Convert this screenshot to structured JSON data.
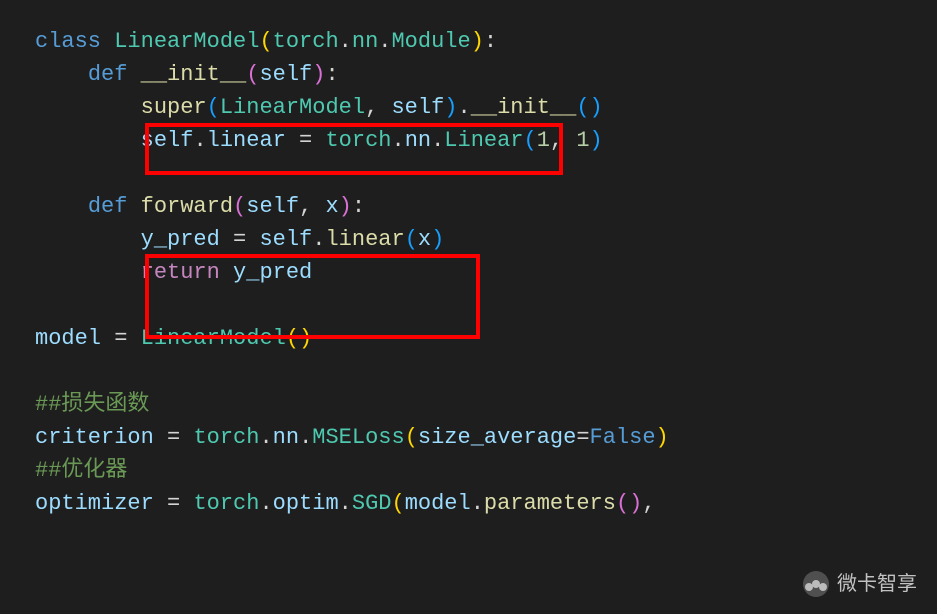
{
  "code": {
    "l1": {
      "t1": "class ",
      "t2": "LinearModel",
      "t3": "(",
      "t4": "torch",
      "t5": ".",
      "t6": "nn",
      "t7": ".",
      "t8": "Module",
      "t9": ")",
      "t10": ":"
    },
    "l2": {
      "t1": "    ",
      "t2": "def ",
      "t3": "__init__",
      "t4": "(",
      "t5": "self",
      "t6": ")",
      "t7": ":"
    },
    "l3": {
      "t1": "        ",
      "t2": "super",
      "t3": "(",
      "t4": "LinearModel",
      "t5": ", ",
      "t6": "self",
      "t7": ")",
      "t8": ".",
      "t9": "__init__",
      "t10": "()"
    },
    "l4": {
      "t1": "        ",
      "t2": "self",
      "t3": ".",
      "t4": "linear",
      "t5": " = ",
      "t6": "torch",
      "t7": ".",
      "t8": "nn",
      "t9": ".",
      "t10": "Linear",
      "t11": "(",
      "t12": "1",
      "t13": ", ",
      "t14": "1",
      "t15": ")"
    },
    "l5": {
      "t1": "    ",
      "t2": "def ",
      "t3": "forward",
      "t4": "(",
      "t5": "self",
      "t6": ", ",
      "t7": "x",
      "t8": ")",
      "t9": ":"
    },
    "l6": {
      "t1": "        ",
      "t2": "y_pred",
      "t3": " = ",
      "t4": "self",
      "t5": ".",
      "t6": "linear",
      "t7": "(",
      "t8": "x",
      "t9": ")"
    },
    "l7": {
      "t1": "        ",
      "t2": "return ",
      "t3": "y_pred"
    },
    "l8": {
      "t1": "model",
      "t2": " = ",
      "t3": "LinearModel",
      "t4": "()"
    },
    "l9": {
      "t1": "##损失函数"
    },
    "l10": {
      "t1": "criterion",
      "t2": " = ",
      "t3": "torch",
      "t4": ".",
      "t5": "nn",
      "t6": ".",
      "t7": "MSELoss",
      "t8": "(",
      "t9": "size_average",
      "t10": "=",
      "t11": "False",
      "t12": ")"
    },
    "l11": {
      "t1": "##优化器"
    },
    "l12": {
      "t1": "optimizer",
      "t2": " = ",
      "t3": "torch",
      "t4": ".",
      "t5": "optim",
      "t6": ".",
      "t7": "SGD",
      "t8": "(",
      "t9": "model",
      "t10": ".",
      "t11": "parameters",
      "t12": "()",
      "t13": ","
    }
  },
  "watermark": "微卡智享"
}
